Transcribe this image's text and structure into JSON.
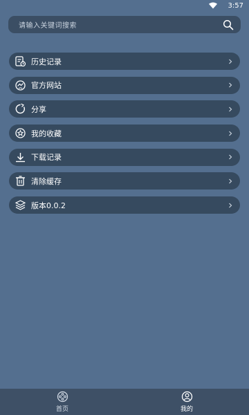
{
  "status_bar": {
    "time": "3:57",
    "icons": [
      "wifi-icon",
      "battery-icon"
    ]
  },
  "search": {
    "placeholder": "请输入关键词搜索",
    "icon": "search-icon"
  },
  "menu": {
    "items": [
      {
        "label": "历史记录",
        "icon": "history-icon"
      },
      {
        "label": "官方网站",
        "icon": "website-icon"
      },
      {
        "label": "分享",
        "icon": "share-icon"
      },
      {
        "label": "我的收藏",
        "icon": "favorite-icon"
      },
      {
        "label": "下载记录",
        "icon": "download-icon"
      },
      {
        "label": "清除缓存",
        "icon": "clear-cache-icon"
      },
      {
        "label": "版本0.0.2",
        "icon": "version-icon"
      }
    ]
  },
  "tabbar": {
    "items": [
      {
        "label": "首页",
        "icon": "home-film-icon",
        "active": false
      },
      {
        "label": "我的",
        "icon": "profile-icon",
        "active": true
      }
    ]
  },
  "colors": {
    "background": "#546F8F",
    "item_background": "#364A5F",
    "tabbar_background": "#3E5066"
  }
}
